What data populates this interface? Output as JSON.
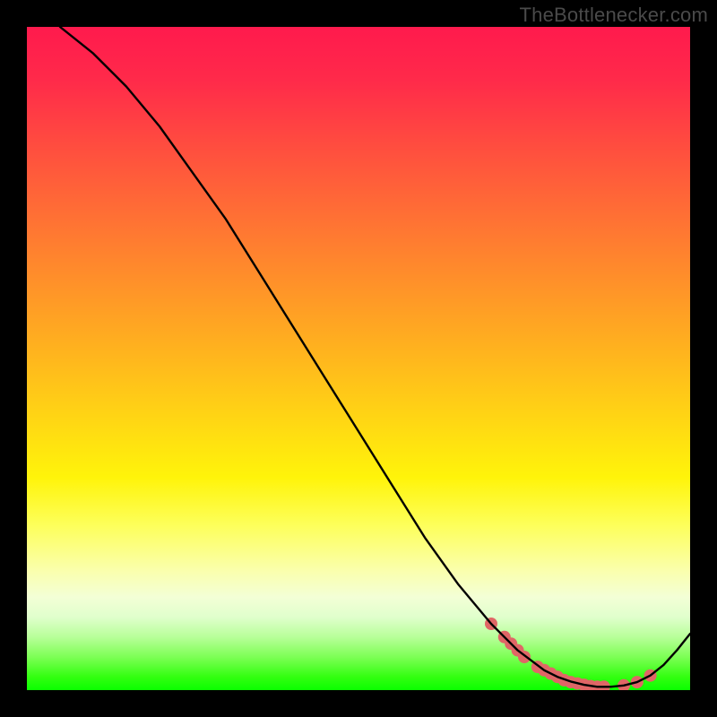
{
  "watermark": "TheBottlenecker.com",
  "colors": {
    "frame": "#000000",
    "gradient_top": "#ff1a4d",
    "gradient_mid1": "#ff8f2a",
    "gradient_mid2": "#fff40a",
    "gradient_bottom": "#0aff00",
    "curve": "#000000",
    "markers": "#e06666"
  },
  "chart_data": {
    "type": "line",
    "title": "",
    "xlabel": "",
    "ylabel": "",
    "xlim": [
      0,
      100
    ],
    "ylim": [
      0,
      100
    ],
    "series": [
      {
        "name": "curve",
        "x": [
          5,
          10,
          15,
          20,
          25,
          30,
          35,
          40,
          45,
          50,
          55,
          60,
          65,
          70,
          72,
          74,
          76,
          78,
          80,
          82,
          84,
          86,
          88,
          90,
          92,
          94,
          96,
          98,
          100
        ],
        "y": [
          100,
          96,
          91,
          85,
          78,
          71,
          63,
          55,
          47,
          39,
          31,
          23,
          16,
          10,
          8,
          6,
          4.5,
          3,
          2,
          1.3,
          0.8,
          0.5,
          0.5,
          0.7,
          1.2,
          2.2,
          3.8,
          6,
          8.5
        ]
      }
    ],
    "markers": {
      "name": "highlight-dots",
      "x": [
        70,
        72,
        73,
        74,
        75,
        77,
        78,
        79,
        80,
        81,
        82,
        83,
        84,
        85,
        86,
        87,
        90,
        92,
        94
      ],
      "y": [
        10,
        8,
        7,
        6,
        5,
        3.5,
        3,
        2.5,
        2,
        1.5,
        1.2,
        1,
        0.8,
        0.6,
        0.5,
        0.5,
        0.7,
        1.2,
        2.2
      ]
    }
  }
}
